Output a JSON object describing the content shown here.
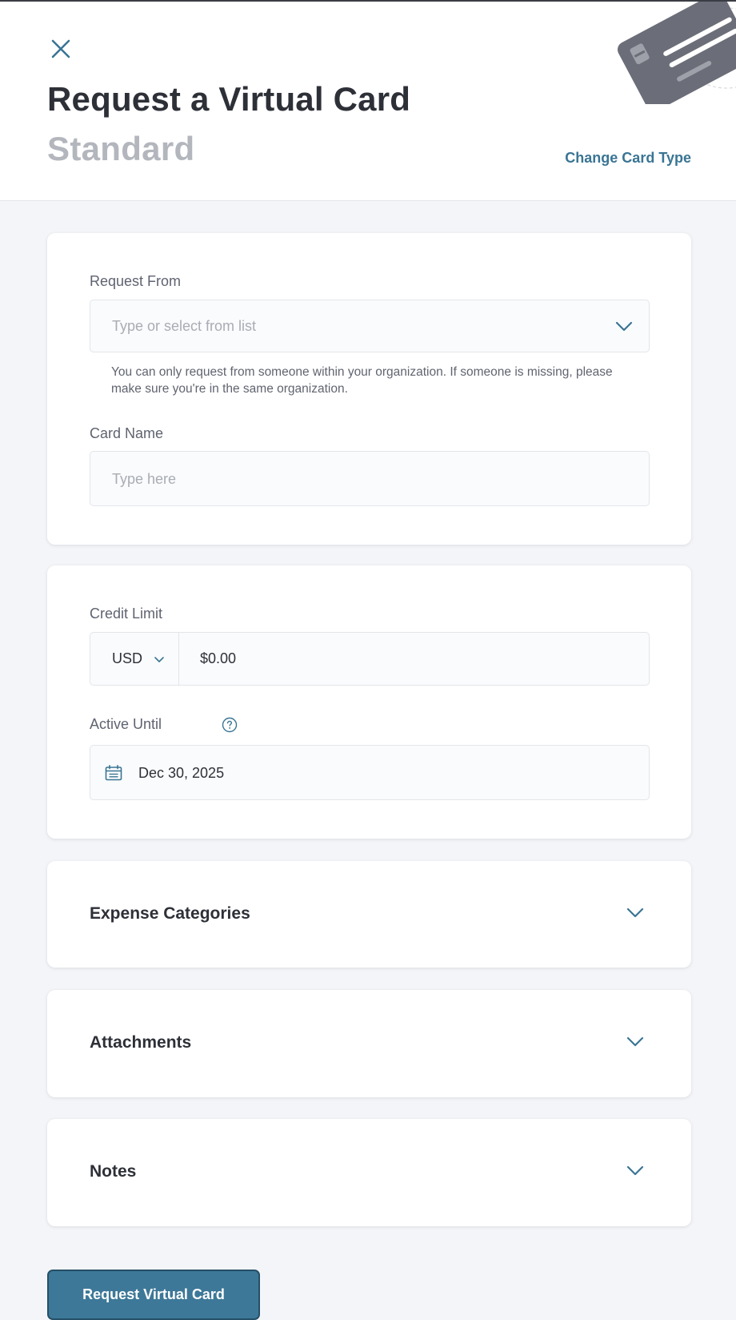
{
  "header": {
    "title": "Request a Virtual Card",
    "subtitle": "Standard",
    "change_card_type": "Change Card Type"
  },
  "request_from": {
    "label": "Request From",
    "placeholder": "Type or select from list",
    "helper": "You can only request from someone within your organization. If someone is missing, please make sure you're in the same organization."
  },
  "card_name": {
    "label": "Card Name",
    "placeholder": "Type here"
  },
  "credit_limit": {
    "label": "Credit Limit",
    "currency": "USD",
    "amount": "$0.00"
  },
  "active_until": {
    "label": "Active Until",
    "date": "Dec 30, 2025"
  },
  "sections": {
    "expense_categories": "Expense Categories",
    "attachments": "Attachments",
    "notes": "Notes"
  },
  "submit_label": "Request Virtual Card",
  "colors": {
    "accent": "#3a7594",
    "button": "#3d7898",
    "heading": "#2e3038",
    "subtitle": "#b3b6bd",
    "background": "#f4f5f8"
  },
  "icons": [
    "close-icon",
    "chevron-down-icon",
    "help-circle-icon",
    "calendar-icon",
    "credit-card-illustration"
  ]
}
